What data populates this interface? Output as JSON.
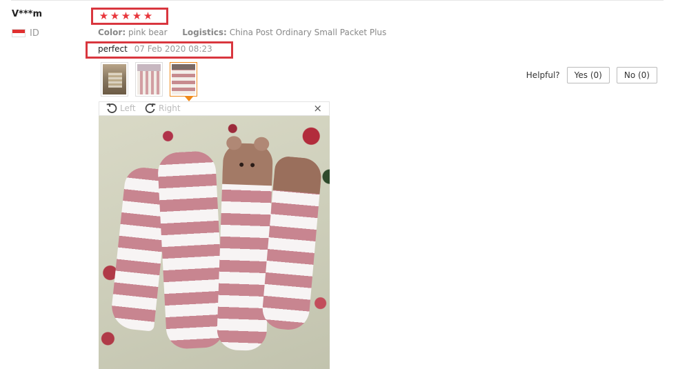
{
  "review": {
    "user_name": "V***m",
    "country_code": "ID",
    "rating": 5,
    "color_label": "Color:",
    "color_value": "pink bear",
    "logistics_label": "Logistics:",
    "logistics_value": "China Post Ordinary Small Packet Plus",
    "feedback_text": "perfect",
    "date": "07 Feb 2020 08:23"
  },
  "helpful": {
    "label": "Helpful?",
    "yes_label": "Yes (0)",
    "no_label": "No (0)"
  },
  "viewer": {
    "rotate_left_label": "Left",
    "rotate_right_label": "Right",
    "close_symbol": "×",
    "selected_thumb": 3
  },
  "colors": {
    "star": "#e8363c",
    "highlight_box": "#d9363e",
    "active_thumb_border": "#f08a1a"
  },
  "icons": [
    "star-icon",
    "flag-icon",
    "rotate-left-icon",
    "rotate-right-icon",
    "close-icon"
  ]
}
